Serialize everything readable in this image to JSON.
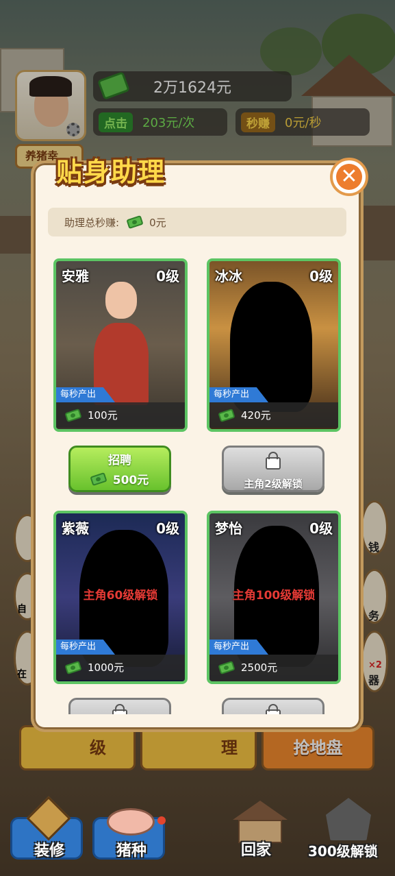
{
  "hud": {
    "money": "2万1624元",
    "click_label": "点击",
    "click_value": "203元/次",
    "persec_label": "秒赚",
    "persec_value": "0元/秒",
    "farm_label": "养猪幸"
  },
  "modal": {
    "title": "贴身助理",
    "total_label": "助理总秒赚:",
    "total_value": "0元",
    "persec_tag": "每秒产出"
  },
  "assistants": [
    {
      "name": "安雅",
      "level": "0级",
      "income": "100元",
      "unlocked": true
    },
    {
      "name": "冰冰",
      "level": "0级",
      "income": "420元",
      "unlocked": false
    },
    {
      "name": "紫薇",
      "level": "0级",
      "income": "1000元",
      "unlocked": false,
      "lock_text": "主角60级解锁"
    },
    {
      "name": "梦怡",
      "level": "0级",
      "income": "2500元",
      "unlocked": false,
      "lock_text": "主角100级解锁"
    }
  ],
  "buttons": {
    "recruit_label": "招聘",
    "recruit_cost": "500元",
    "unlock_2": "主角2级解锁"
  },
  "behind": {
    "left_partial": "级",
    "mid_partial": "理",
    "right": "抢地盘",
    "side_right_1": "钱",
    "side_right_2": "务",
    "side_left_1": "自",
    "side_left_2": "在",
    "side_right_3": "器",
    "badge": "×2"
  },
  "bottom_nav": [
    {
      "label": "装修"
    },
    {
      "label": "猪种"
    },
    {
      "label": "回家"
    },
    {
      "label": "300级解锁"
    }
  ],
  "colors": {
    "card_border": "#5cc463",
    "accent_orange": "#ed7d2e",
    "tag_blue": "#2f7ad6",
    "lock_red": "#e53a35"
  }
}
